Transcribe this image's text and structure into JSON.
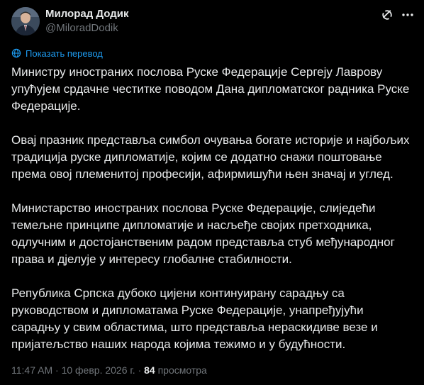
{
  "author": {
    "name": "Милорад Додик",
    "handle": "@MiloradDodik"
  },
  "actions": {
    "grok_icon": "grok-icon",
    "more_icon": "more-icon"
  },
  "translate": {
    "label": "Показать перевод",
    "icon": "globe-icon"
  },
  "paragraphs": [
    "Министру иностраних послова Руске Федерације Сергеју Лаврову упућујем срдачне честитке поводом Дана дипломатског радника Руске Федерације.",
    "Овај празник представља симбол очувања богате историје и најбољих традиција руске дипломатије, којим се додатно снажи поштовање према овој племенитој професији, афирмишући њен значај и углед.",
    "Министарство иностраних послова Руске Федерације, слиједећи темељне принципе дипломатије и насљеђе својих претходника, одлучним и достојанственим радом представља стуб међународног права и дјелује у интересу глобалне стабилности.",
    "Република Српска дубоко цијени континуирану сарадњу са руководством и дипломатама Руске Федерације, унапређујући сарадњу у свим областима, што представља нераскидиве везе и пријатељство наших народа којима тежимо и у будућности."
  ],
  "meta": {
    "time": "11:47 AM",
    "separator1": "·",
    "date": "10 февр. 2026 г.",
    "separator2": "·",
    "views_count": "84",
    "views_label": "просмотра"
  },
  "colors": {
    "background": "#000000",
    "text": "#e7e9ea",
    "secondary": "#71767b",
    "link": "#1d9bf0"
  }
}
